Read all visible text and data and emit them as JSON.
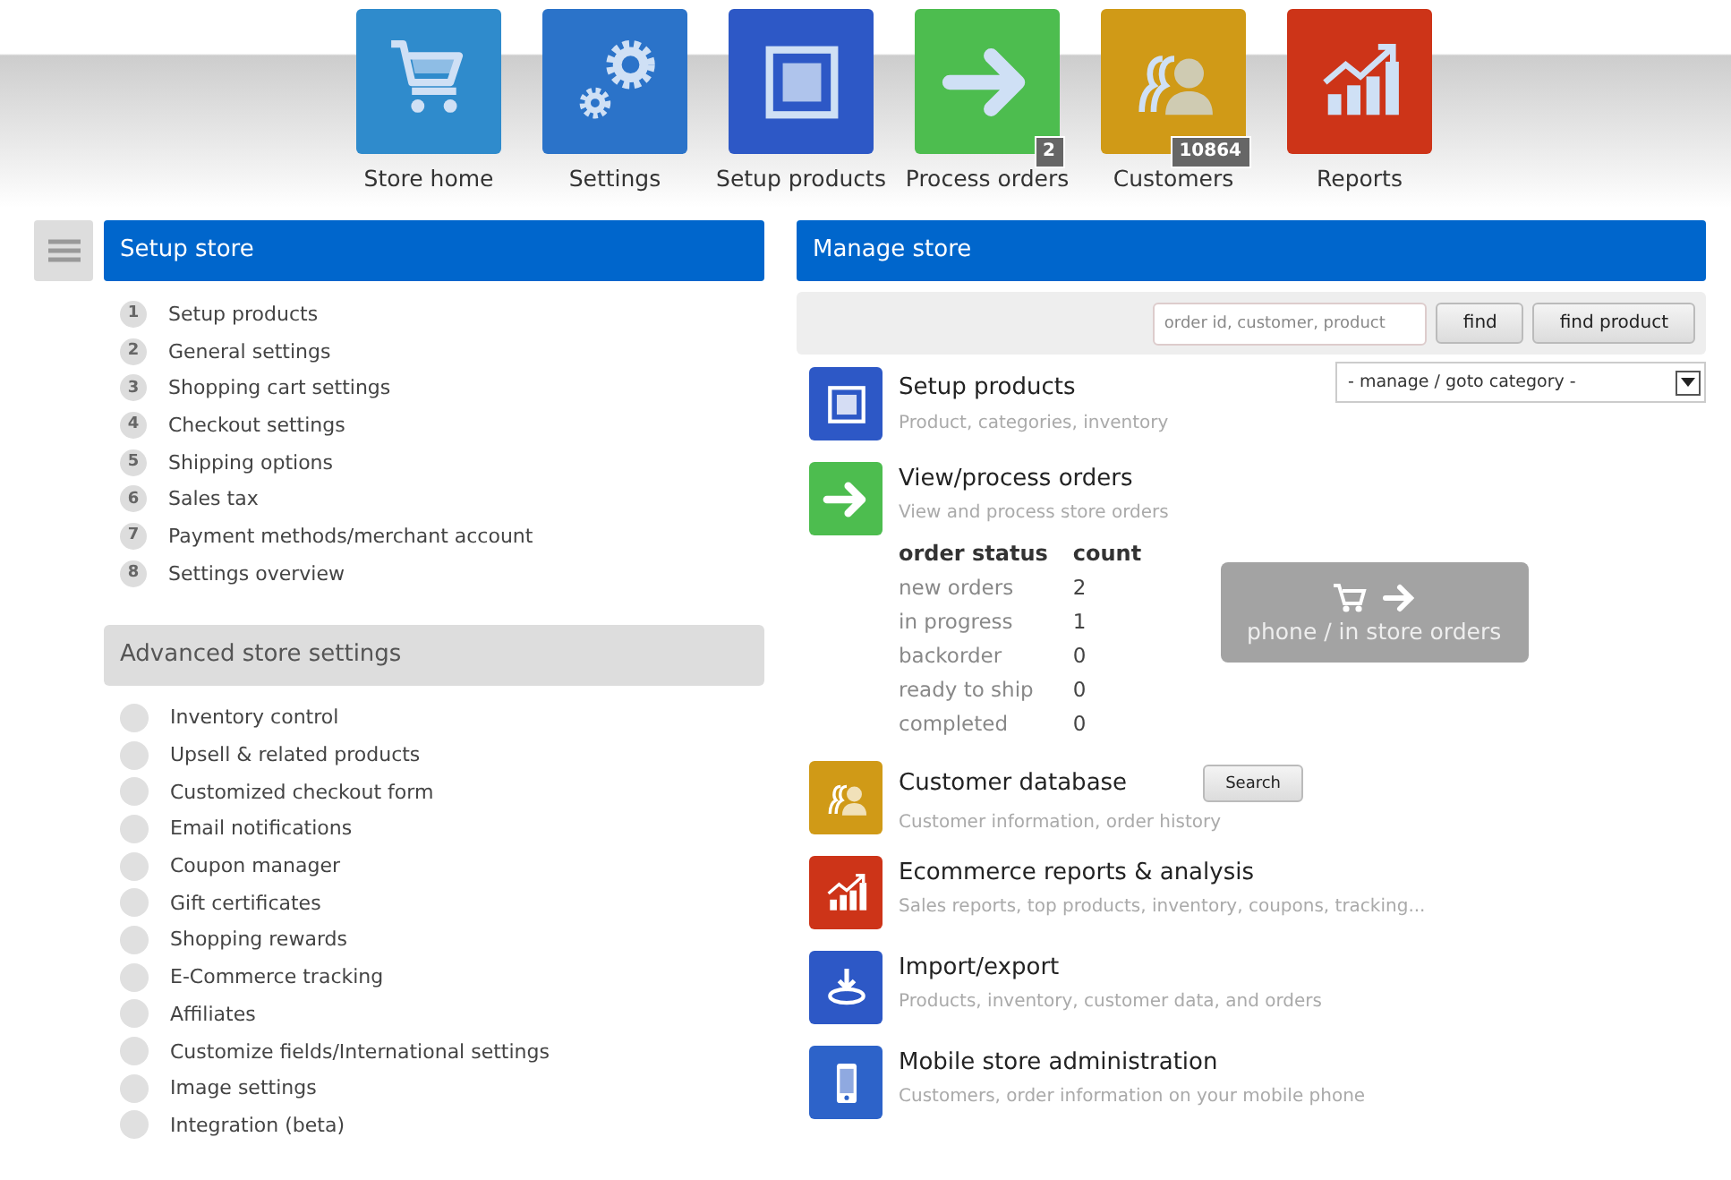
{
  "nav": [
    {
      "label": "Store home"
    },
    {
      "label": "Settings"
    },
    {
      "label": "Setup products"
    },
    {
      "label": "Process orders",
      "badge": "2"
    },
    {
      "label": "Customers",
      "badge": "10864"
    },
    {
      "label": "Reports"
    }
  ],
  "setup_store": {
    "title": "Setup store",
    "items": [
      {
        "number": "1",
        "label": "Setup products"
      },
      {
        "number": "2",
        "label": "General settings"
      },
      {
        "number": "3",
        "label": "Shopping cart settings"
      },
      {
        "number": "4",
        "label": "Checkout settings"
      },
      {
        "number": "5",
        "label": "Shipping options"
      },
      {
        "number": "6",
        "label": "Sales tax"
      },
      {
        "number": "7",
        "label": "Payment methods/merchant account"
      },
      {
        "number": "8",
        "label": "Settings overview"
      }
    ]
  },
  "advanced": {
    "title": "Advanced store settings",
    "items": [
      "Inventory control",
      "Upsell & related products",
      "Customized checkout form",
      "Email notifications",
      "Coupon manager",
      "Gift certificates",
      "Shopping rewards",
      "E-Commerce tracking",
      "Affiliates",
      "Customize fields/International settings",
      "Image settings",
      "Integration (beta)"
    ]
  },
  "manage_store": {
    "title": "Manage store",
    "search": {
      "placeholder": "order id, customer, product"
    },
    "buttons": [
      "find",
      "find product"
    ],
    "sections": [
      {
        "title": "Setup products",
        "subtitle": "Product, categories, inventory",
        "dropdown": "- manage / goto category -"
      },
      {
        "title": "View/process orders",
        "subtitle": "View and process store orders",
        "order_table": {
          "columns": [
            "order status",
            "count"
          ],
          "rows": [
            [
              "new orders",
              "2"
            ],
            [
              "in progress",
              "1"
            ],
            [
              "backorder",
              "0"
            ],
            [
              "ready to ship",
              "0"
            ],
            [
              "completed",
              "0"
            ]
          ]
        },
        "action": "phone / in store orders"
      },
      {
        "title": "Customer database",
        "subtitle": "Customer information, order history",
        "button": "Search"
      },
      {
        "title": "Ecommerce reports & analysis",
        "subtitle": "Sales reports, top products, inventory, coupons, tracking..."
      },
      {
        "title": "Import/export",
        "subtitle": "Products, inventory, customer data, and orders"
      },
      {
        "title": "Mobile store administration",
        "subtitle": "Customers, order information on your mobile phone"
      }
    ]
  }
}
